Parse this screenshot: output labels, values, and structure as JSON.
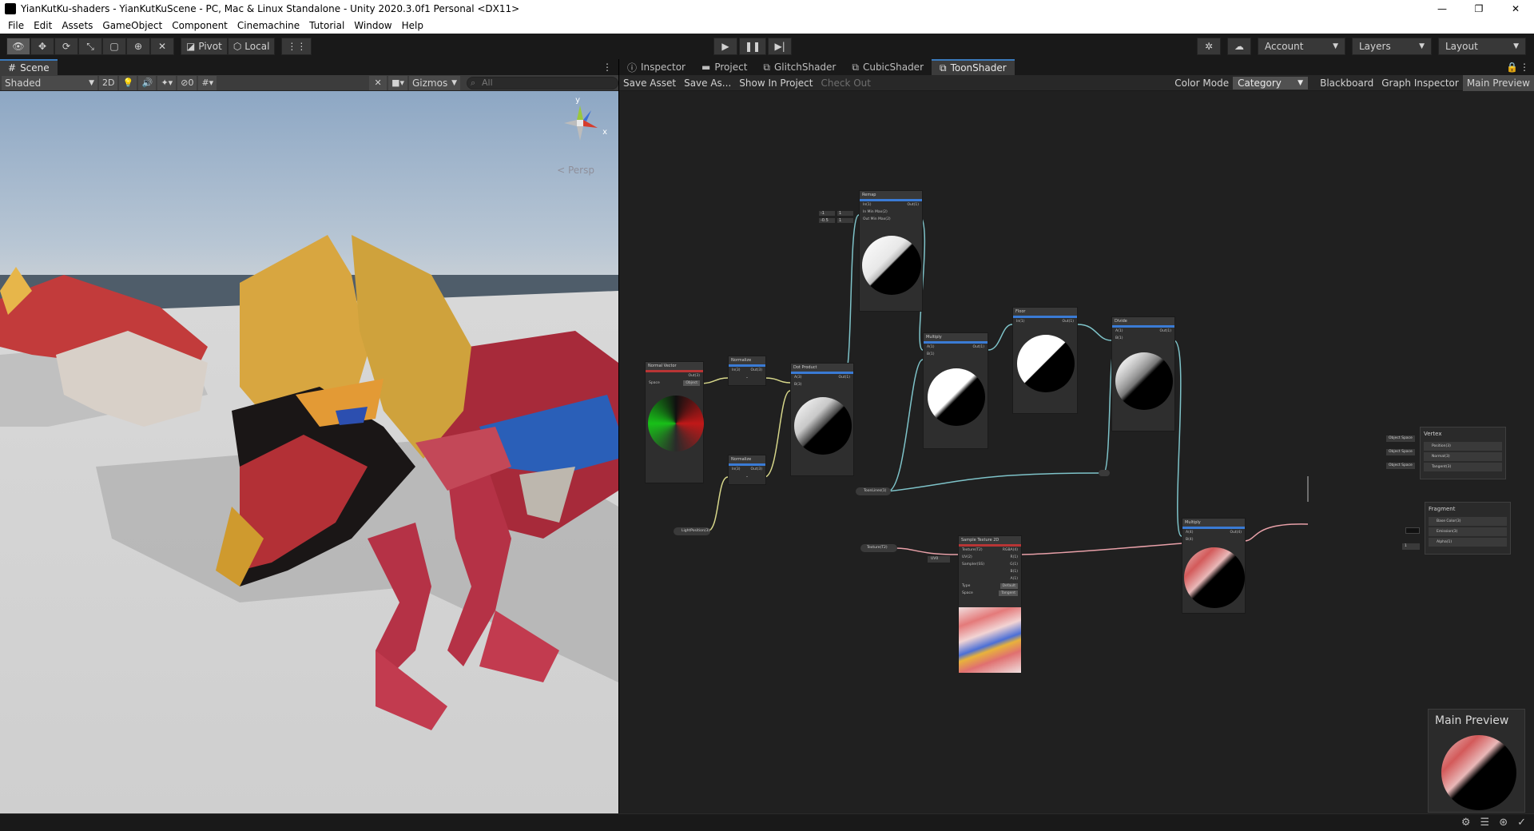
{
  "window": {
    "title": "YianKutKu-shaders - YianKutKuScene - PC, Mac & Linux Standalone - Unity 2020.3.0f1 Personal <DX11>",
    "minimize_glyph": "—",
    "maximize_glyph": "❐",
    "close_glyph": "✕"
  },
  "menu": [
    "File",
    "Edit",
    "Assets",
    "GameObject",
    "Component",
    "Cinemachine",
    "Tutorial",
    "Window",
    "Help"
  ],
  "toolbar": {
    "pivot_label": "Pivot",
    "local_label": "Local",
    "account_label": "Account",
    "layers_label": "Layers",
    "layout_label": "Layout"
  },
  "scene": {
    "tab_label": "Scene",
    "shading_mode": "Shaded",
    "mode_2d": "2D",
    "hidden_count": "0",
    "gizmos_label": "Gizmos",
    "search_placeholder": "All",
    "persp_label": "< Persp",
    "axis_y": "y",
    "axis_x": "x"
  },
  "graph_tabs": [
    "Inspector",
    "Project",
    "GlitchShader",
    "CubicShader",
    "ToonShader"
  ],
  "graph_toolbar": {
    "save_asset": "Save Asset",
    "save_as": "Save As...",
    "show_in_project": "Show In Project",
    "check_out": "Check Out",
    "color_mode_label": "Color Mode",
    "color_mode_value": "Category",
    "blackboard": "Blackboard",
    "graph_inspector": "Graph Inspector",
    "main_preview": "Main Preview"
  },
  "nodes": {
    "normal_vector": {
      "title": "Normal Vector",
      "out": "Out(3)",
      "space_label": "Space",
      "space_value": "Object"
    },
    "normalize1": {
      "title": "Normalize",
      "in": "In(3)",
      "out": "Out(3)"
    },
    "normalize2": {
      "title": "Normalize",
      "in": "In(3)",
      "out": "Out(3)"
    },
    "dot_product": {
      "title": "Dot Product",
      "a": "A(3)",
      "b": "B(3)",
      "out": "Out(1)"
    },
    "remap": {
      "title": "Remap",
      "in": "In(1)",
      "in_minmax": "In Min Max(2)",
      "out_minmax": "Out Min Max(2)",
      "out": "Out(1)",
      "v1": "-1",
      "v2": "1",
      "v3": "-0.5",
      "v4": "1"
    },
    "multiply1": {
      "title": "Multiply",
      "a": "A(1)",
      "b": "B(1)",
      "out": "Out(1)"
    },
    "floor": {
      "title": "Floor",
      "in": "In(1)",
      "out": "Out(1)"
    },
    "divide": {
      "title": "Divide",
      "a": "A(1)",
      "b": "B(1)",
      "out": "Out(1)"
    },
    "multiply2": {
      "title": "Multiply",
      "a": "A(4)",
      "b": "B(4)",
      "out": "Out(4)"
    },
    "sample_tex": {
      "title": "Sample Texture 2D",
      "texture": "Texture(T2)",
      "uv": "UV(2)",
      "sampler": "Sampler(SS)",
      "rgba": "RGBA(4)",
      "r": "R(1)",
      "g": "G(1)",
      "b": "B(1)",
      "a": "A(1)",
      "type_label": "Type",
      "type_value": "Default",
      "space_label": "Space",
      "space_value": "Tangent",
      "uv_chip": "UV0"
    },
    "light_pos": {
      "label": "LightPosition(3)"
    },
    "toon_lines": {
      "label": "ToonLines(1)"
    },
    "texture_prop": {
      "label": "Texture(T2)"
    }
  },
  "vertex_stack": {
    "title": "Vertex",
    "rows": [
      "Position(3)",
      "Normal(3)",
      "Tangent(3)"
    ],
    "chips": [
      "Object Space",
      "Object Space",
      "Object Space"
    ]
  },
  "fragment_stack": {
    "title": "Fragment",
    "rows": [
      "Base Color(3)",
      "Emission(3)",
      "Alpha(1)"
    ],
    "alpha_chip": "1"
  },
  "main_preview_panel": {
    "title": "Main Preview"
  }
}
